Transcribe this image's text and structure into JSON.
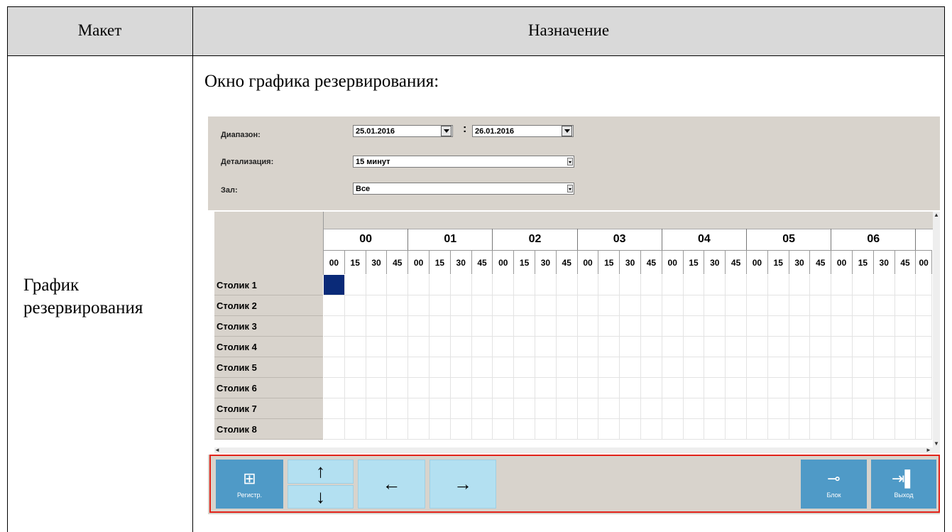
{
  "doc": {
    "col_layout": "Макет",
    "col_purpose": "Назначение",
    "row_title": "График резервирования",
    "caption": "Окно графика резервирования:"
  },
  "app": {
    "range_label": "Диапазон:",
    "date_from": "25.01.2016",
    "date_to": "26.01.2016",
    "range_separator": ":",
    "detail_label": "Детализация:",
    "detail_value": "15 минут",
    "hall_label": "Зал:",
    "hall_value": "Все",
    "hours": [
      "00",
      "01",
      "02",
      "03",
      "04",
      "05",
      "06"
    ],
    "minutes": [
      "00",
      "15",
      "30",
      "45"
    ],
    "minute_overflow": "00",
    "tables": [
      "Столик 1",
      "Столик 2",
      "Столик 3",
      "Столик 4",
      "Столик 5",
      "Столик 6",
      "Столик 7",
      "Столик 8"
    ],
    "selected_cell": {
      "table": "Столик 1",
      "slot": "00:00"
    },
    "selected_color": "#0a2a78"
  },
  "toolbar": {
    "register_label": "Регистр.",
    "register_icon": "plus-icon",
    "up_icon": "arrow-up-icon",
    "down_icon": "arrow-down-icon",
    "left_icon": "arrow-left-icon",
    "right_icon": "arrow-right-icon",
    "lock_label": "Блок",
    "lock_icon": "key-icon",
    "exit_label": "Выход",
    "exit_icon": "exit-door-icon",
    "button_color": "#b3e0f1",
    "accent_button_color": "#4f9ac7",
    "frame_color": "#e2231a"
  }
}
